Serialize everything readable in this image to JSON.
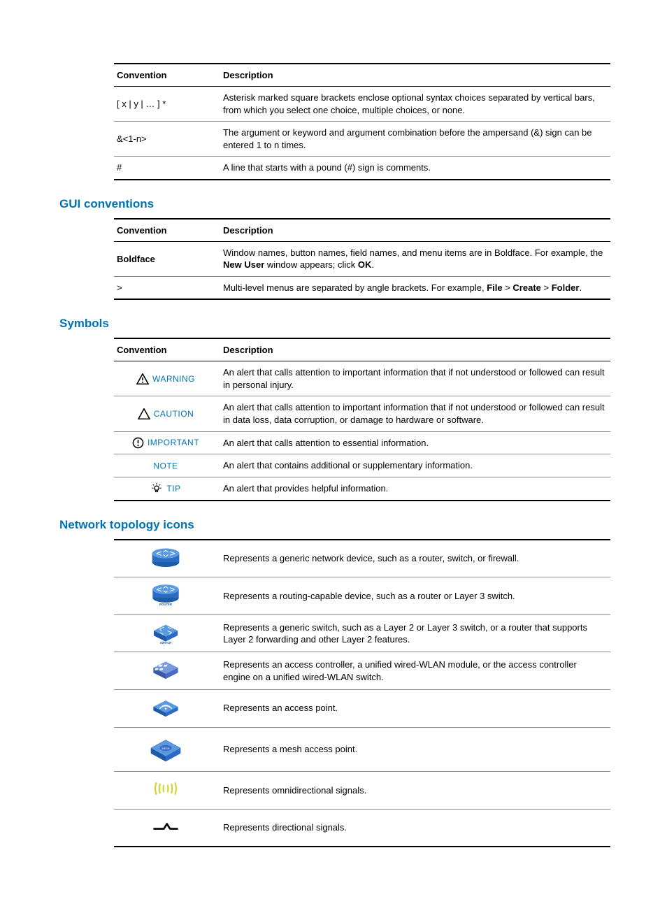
{
  "tables": {
    "t1": {
      "headers": [
        "Convention",
        "Description"
      ],
      "rows": [
        {
          "c": "[ x | y | … ] *",
          "d": "Asterisk marked square brackets enclose optional syntax choices separated by vertical bars, from which you select one choice, multiple choices, or none."
        },
        {
          "c": "&<1-n>",
          "d": "The argument or keyword and argument combination before the ampersand (&) sign can be entered 1 to n times."
        },
        {
          "c": "#",
          "d": "A line that starts with a pound (#) sign is comments."
        }
      ]
    },
    "t2": {
      "title": "GUI conventions",
      "headers": [
        "Convention",
        "Description"
      ],
      "rows": [
        {
          "c": "Boldface",
          "d_parts": [
            "Window names, button names, field names, and menu items are in Boldface. For example, the ",
            "New User",
            " window appears; click ",
            "OK",
            "."
          ]
        },
        {
          "c": ">",
          "d_parts": [
            "Multi-level menus are separated by angle brackets. For example, ",
            "File",
            " > ",
            "Create",
            " > ",
            "Folder",
            "."
          ]
        }
      ]
    },
    "t3": {
      "title": "Symbols",
      "headers": [
        "Convention",
        "Description"
      ],
      "rows": [
        {
          "label": "WARNING",
          "d": "An alert that calls attention to important information that if not understood or followed can result in personal injury."
        },
        {
          "label": "CAUTION",
          "d": "An alert that calls attention to important information that if not understood or followed can result in data loss, data corruption, or damage to hardware or software."
        },
        {
          "label": "IMPORTANT",
          "d": "An alert that calls attention to essential information."
        },
        {
          "label": "NOTE",
          "d": "An alert that contains additional or supplementary information."
        },
        {
          "label": "TIP",
          "d": "An alert that provides helpful information."
        }
      ]
    },
    "t4": {
      "title": "Network topology icons",
      "rows": [
        {
          "d": "Represents a generic network device, such as a router, switch, or firewall."
        },
        {
          "d": "Represents a routing-capable device, such as a router or Layer 3 switch."
        },
        {
          "d": "Represents a generic switch, such as a Layer 2 or Layer 3 switch, or a router that supports Layer 2 forwarding and other Layer 2 features."
        },
        {
          "d": "Represents an access controller, a unified wired-WLAN module, or the access controller engine on a unified wired-WLAN switch."
        },
        {
          "d": "Represents an access point."
        },
        {
          "d": "Represents a mesh access point."
        },
        {
          "d": "Represents omnidirectional signals."
        },
        {
          "d": "Represents directional signals."
        }
      ]
    }
  }
}
